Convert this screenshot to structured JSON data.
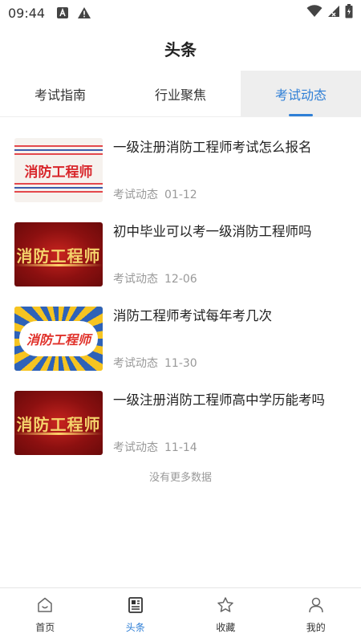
{
  "status_bar": {
    "time": "09:44",
    "icons": [
      "notification-a-icon",
      "warning-icon",
      "wifi-icon",
      "signal-icon",
      "battery-icon"
    ]
  },
  "header": {
    "title": "头条"
  },
  "tabs": [
    {
      "label": "考试指南",
      "active": false
    },
    {
      "label": "行业聚焦",
      "active": false
    },
    {
      "label": "考试动态",
      "active": true
    }
  ],
  "articles": [
    {
      "title": "一级注册消防工程师考试怎么报名",
      "category": "考试动态",
      "date": "01-12",
      "thumb_text": "消防工程师"
    },
    {
      "title": "初中毕业可以考一级消防工程师吗",
      "category": "考试动态",
      "date": "12-06",
      "thumb_text": "消防工程师"
    },
    {
      "title": "消防工程师考试每年考几次",
      "category": "考试动态",
      "date": "11-30",
      "thumb_text": "消防工程师"
    },
    {
      "title": "一级注册消防工程师高中学历能考吗",
      "category": "考试动态",
      "date": "11-14",
      "thumb_text": "消防工程师"
    }
  ],
  "list_footer": "没有更多数据",
  "bottom_nav": [
    {
      "label": "首页",
      "icon": "home-icon",
      "active": false
    },
    {
      "label": "头条",
      "icon": "news-icon",
      "active": true
    },
    {
      "label": "收藏",
      "icon": "star-icon",
      "active": false
    },
    {
      "label": "我的",
      "icon": "user-icon",
      "active": false
    }
  ],
  "colors": {
    "accent": "#2f7fd6",
    "text": "#222222",
    "muted": "#999999",
    "active_tab_bg": "#eeeeee"
  }
}
